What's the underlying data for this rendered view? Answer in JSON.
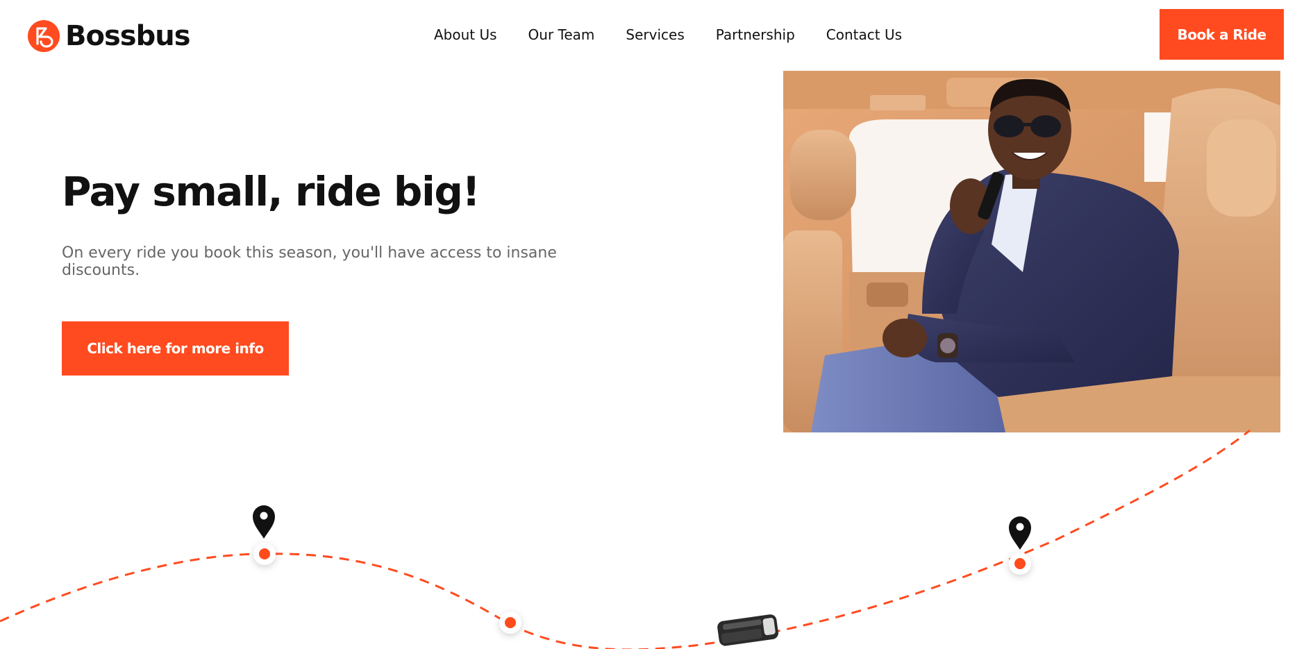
{
  "brand": {
    "name": "Bossbus",
    "logo_icon": "bossbus-logo-icon",
    "accent_color": "#ff4b1f",
    "text_color": "#111111"
  },
  "nav": {
    "items": [
      {
        "label": "About Us"
      },
      {
        "label": "Our Team"
      },
      {
        "label": "Services"
      },
      {
        "label": "Partnership"
      },
      {
        "label": "Contact Us"
      }
    ],
    "cta_label": "Book a Ride"
  },
  "hero": {
    "title": "Pay small, ride big!",
    "subtitle": "On every ride you book this season, you'll have access to insane discounts.",
    "cta_label": "Click here for more info",
    "photo_icon": "man-on-phone-in-car-photo"
  },
  "route": {
    "pin_icon": "map-pin-icon",
    "stop_icon": "route-stop-dot",
    "vehicle_icon": "van-icon"
  }
}
